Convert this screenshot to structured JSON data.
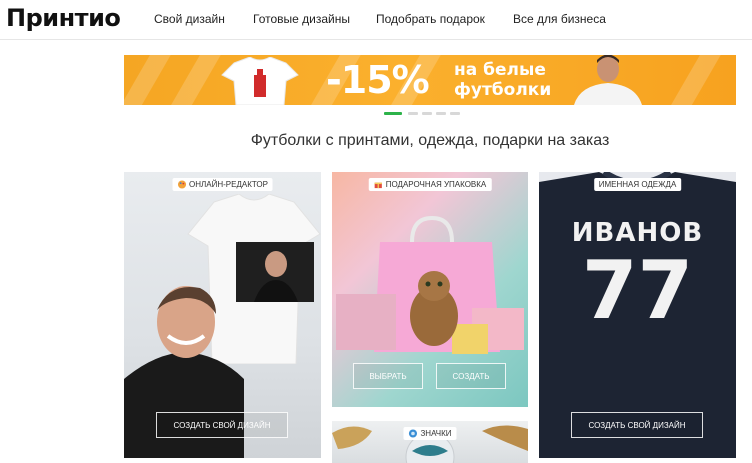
{
  "header": {
    "logo": "Принтио",
    "nav": [
      {
        "label": "Свой дизайн"
      },
      {
        "label": "Готовые дизайны"
      },
      {
        "label": "Подобрать подарок"
      },
      {
        "label": "Все для бизнеса"
      }
    ]
  },
  "banner": {
    "discount": "-15%",
    "line1": "на белые",
    "line2": "футболки",
    "slides_count": 5,
    "active_slide": 1
  },
  "headline": "Футболки с принтами, одежда, подарки на заказ",
  "cards": [
    {
      "badge": "Онлайн-редактор",
      "badge_icon": "palette-icon",
      "button": "Создать свой дизайн"
    },
    {
      "badge": "Подарочная упаковка",
      "badge_icon": "gift-icon",
      "buttons": [
        "Выбрать",
        "Создать"
      ]
    },
    {
      "badge": "Именная одежда",
      "jersey_name": "ИВАНОВ",
      "jersey_number": "77",
      "button": "Создать свой дизайн"
    },
    {
      "badge": "Значки",
      "badge_icon": "badge-pin-icon"
    }
  ],
  "colors": {
    "accent": "#2db34a",
    "banner": "#f7a21f"
  }
}
